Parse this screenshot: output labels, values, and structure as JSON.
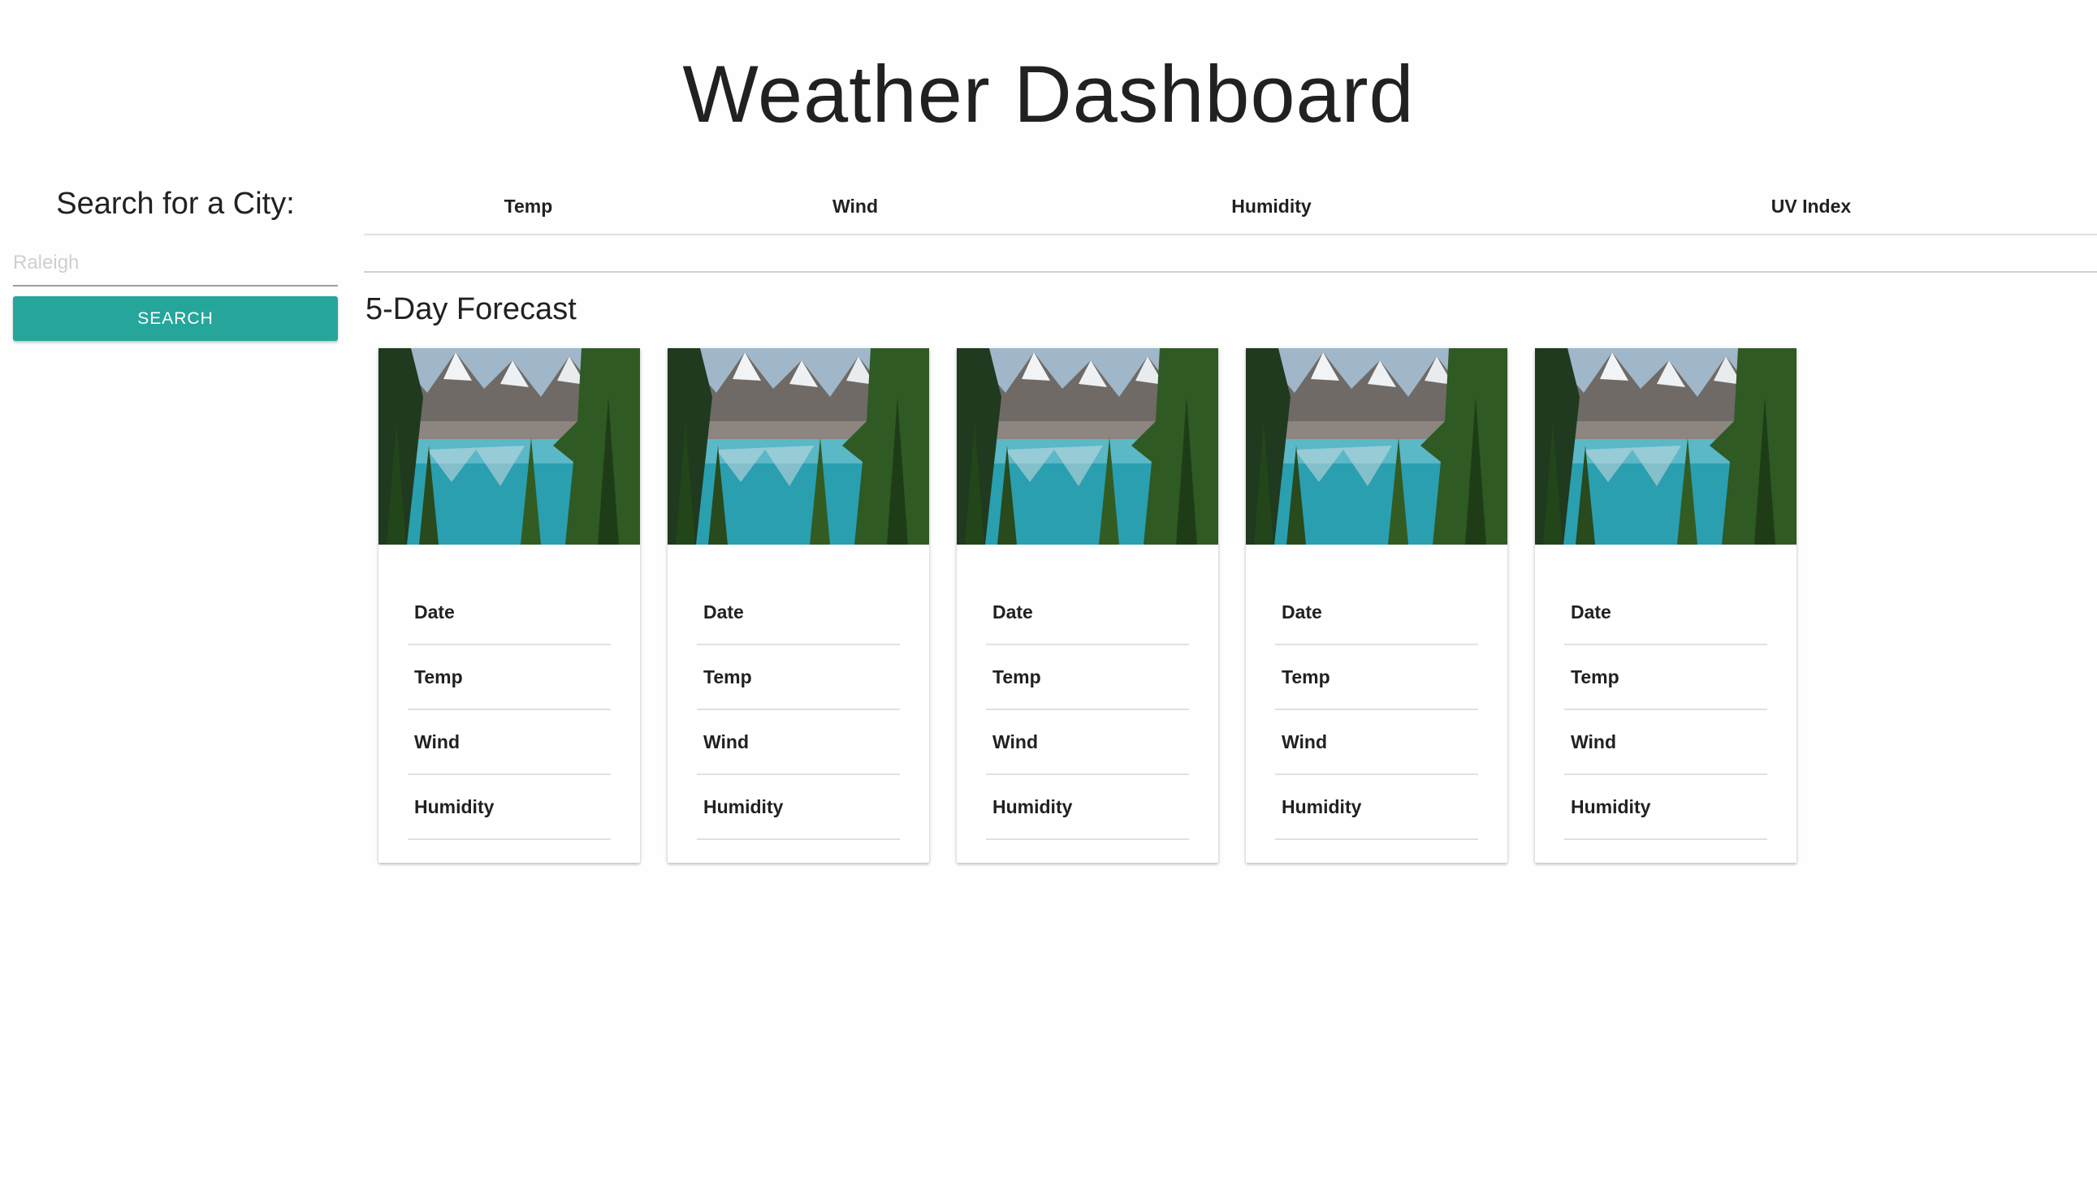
{
  "header": {
    "title": "Weather Dashboard"
  },
  "search": {
    "label": "Search for a City:",
    "placeholder": "Raleigh",
    "button_label": "SEARCH",
    "accent_color": "#26a69a"
  },
  "current": {
    "columns": [
      "Temp",
      "Wind",
      "Humidity",
      "UV Index"
    ]
  },
  "forecast": {
    "heading": "5-Day Forecast",
    "image": "mountain-lake-photo",
    "cards": [
      {
        "rows": [
          "Date",
          "Temp",
          "Wind",
          "Humidity"
        ]
      },
      {
        "rows": [
          "Date",
          "Temp",
          "Wind",
          "Humidity"
        ]
      },
      {
        "rows": [
          "Date",
          "Temp",
          "Wind",
          "Humidity"
        ]
      },
      {
        "rows": [
          "Date",
          "Temp",
          "Wind",
          "Humidity"
        ]
      },
      {
        "rows": [
          "Date",
          "Temp",
          "Wind",
          "Humidity"
        ]
      }
    ]
  }
}
